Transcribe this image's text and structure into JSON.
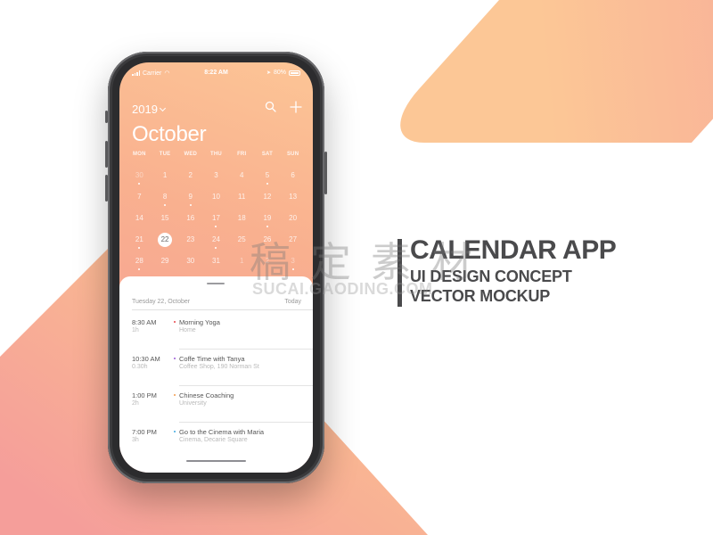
{
  "colors": {
    "gradient_start": "#fcc596",
    "gradient_end": "#f49c97",
    "headline_text": "#4a4a4c",
    "event_dot_colors": [
      "#e8464b",
      "#9b59d6",
      "#f39a4b",
      "#3aa8e0"
    ]
  },
  "status_bar": {
    "carrier": "Carrier",
    "time": "8:22 AM",
    "battery": "80%"
  },
  "header": {
    "year": "2019",
    "month": "October",
    "search_icon": "search-icon",
    "add_icon": "plus-icon"
  },
  "calendar": {
    "weekdays": [
      "MON",
      "TUE",
      "WED",
      "THU",
      "FRI",
      "SAT",
      "SUN"
    ],
    "selected_day": "22",
    "days": [
      {
        "label": "30",
        "muted": true,
        "dot": true
      },
      {
        "label": "1",
        "muted": false,
        "dot": false
      },
      {
        "label": "2",
        "muted": false,
        "dot": false
      },
      {
        "label": "3",
        "muted": false,
        "dot": false
      },
      {
        "label": "4",
        "muted": false,
        "dot": false
      },
      {
        "label": "5",
        "muted": false,
        "dot": true
      },
      {
        "label": "6",
        "muted": false,
        "dot": false
      },
      {
        "label": "7",
        "muted": false,
        "dot": false
      },
      {
        "label": "8",
        "muted": false,
        "dot": true
      },
      {
        "label": "9",
        "muted": false,
        "dot": true
      },
      {
        "label": "10",
        "muted": false,
        "dot": false
      },
      {
        "label": "11",
        "muted": false,
        "dot": false
      },
      {
        "label": "12",
        "muted": false,
        "dot": false
      },
      {
        "label": "13",
        "muted": false,
        "dot": false
      },
      {
        "label": "14",
        "muted": false,
        "dot": false
      },
      {
        "label": "15",
        "muted": false,
        "dot": false
      },
      {
        "label": "16",
        "muted": false,
        "dot": false
      },
      {
        "label": "17",
        "muted": false,
        "dot": true
      },
      {
        "label": "18",
        "muted": false,
        "dot": false
      },
      {
        "label": "19",
        "muted": false,
        "dot": true
      },
      {
        "label": "20",
        "muted": false,
        "dot": false
      },
      {
        "label": "21",
        "muted": false,
        "dot": true
      },
      {
        "label": "22",
        "muted": false,
        "dot": false,
        "selected": true
      },
      {
        "label": "23",
        "muted": false,
        "dot": false
      },
      {
        "label": "24",
        "muted": false,
        "dot": true
      },
      {
        "label": "25",
        "muted": false,
        "dot": false
      },
      {
        "label": "26",
        "muted": false,
        "dot": false
      },
      {
        "label": "27",
        "muted": false,
        "dot": false
      },
      {
        "label": "28",
        "muted": false,
        "dot": true
      },
      {
        "label": "29",
        "muted": false,
        "dot": false
      },
      {
        "label": "30",
        "muted": false,
        "dot": false
      },
      {
        "label": "31",
        "muted": false,
        "dot": false
      },
      {
        "label": "1",
        "muted": true,
        "dot": false
      },
      {
        "label": "2",
        "muted": true,
        "dot": false
      },
      {
        "label": "3",
        "muted": true,
        "dot": true
      }
    ]
  },
  "agenda": {
    "date_label": "Tuesday 22, October",
    "today_label": "Today",
    "events": [
      {
        "time": "8:30 AM",
        "duration": "1h",
        "title": "Morning Yoga",
        "location": "Home",
        "color": "#e8464b"
      },
      {
        "time": "10:30 AM",
        "duration": "0.30h",
        "title": "Coffe Time with Tanya",
        "location": "Coffee Shop, 190 Norman St",
        "color": "#9b59d6"
      },
      {
        "time": "1:00 PM",
        "duration": "2h",
        "title": "Chinese Coaching",
        "location": "University",
        "color": "#f39a4b"
      },
      {
        "time": "7:00 PM",
        "duration": "3h",
        "title": "Go to the Cinema with Maria",
        "location": "Cinema, Decarie Square",
        "color": "#3aa8e0"
      }
    ]
  },
  "headline": {
    "line1": "CALENDAR APP",
    "line2": "UI DESIGN CONCEPT",
    "line3": "VECTOR MOCKUP"
  },
  "watermark": {
    "chinese": "稿定素材",
    "latin": "SUCAI.GAODING.COM"
  }
}
